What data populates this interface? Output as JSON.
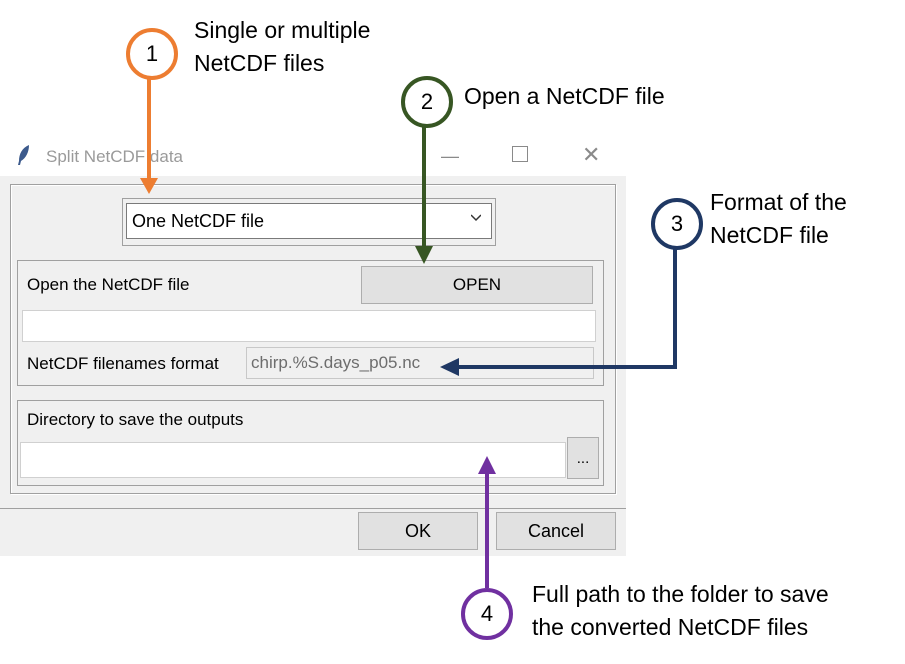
{
  "window": {
    "title": "Split NetCDF data",
    "controls": {
      "minimize": "—",
      "close": "✕"
    }
  },
  "mode_select": {
    "selected": "One NetCDF file"
  },
  "open_group": {
    "label": "Open the NetCDF file",
    "open_button": "OPEN",
    "file_path_value": "",
    "format_label": "NetCDF filenames format",
    "format_value": "chirp.%S.days_p05.nc"
  },
  "output_group": {
    "label": "Directory to save the outputs",
    "directory_value": "",
    "browse_button": "..."
  },
  "buttons": {
    "ok": "OK",
    "cancel": "Cancel"
  },
  "annotations": [
    {
      "number": "1",
      "lines": [
        "Single or multiple",
        "NetCDF files"
      ],
      "color": "#ed7d31"
    },
    {
      "number": "2",
      "lines": [
        "Open a NetCDF file"
      ],
      "color": "#375623"
    },
    {
      "number": "3",
      "lines": [
        "Format of the",
        "NetCDF file"
      ],
      "color": "#1f3864"
    },
    {
      "number": "4",
      "lines": [
        "Full path to the folder to save",
        "the converted NetCDF files"
      ],
      "color": "#7030a0"
    }
  ]
}
